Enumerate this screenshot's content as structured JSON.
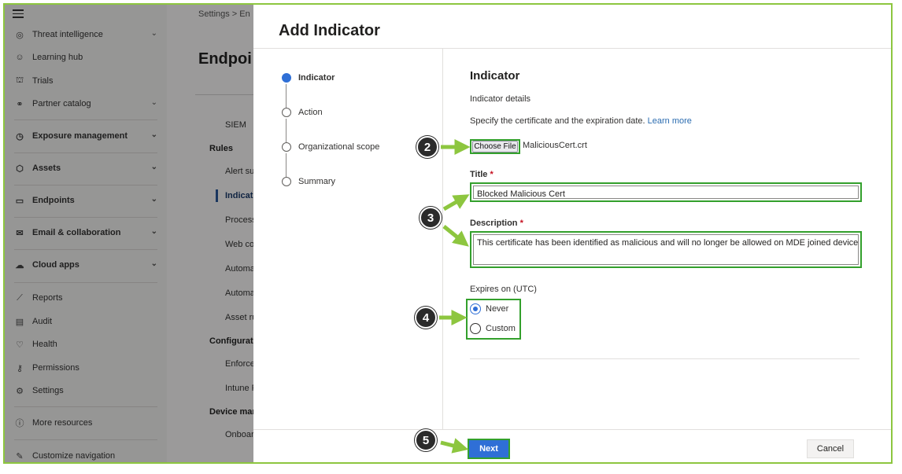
{
  "nav": {
    "items": [
      {
        "label": "Threat intelligence",
        "icon": "threat-intel-icon",
        "chevron": true
      },
      {
        "label": "Learning hub",
        "icon": "learning-hub-icon",
        "chevron": false
      },
      {
        "label": "Trials",
        "icon": "trials-icon",
        "chevron": false
      },
      {
        "label": "Partner catalog",
        "icon": "partner-catalog-icon",
        "chevron": true
      },
      {
        "label": "Exposure management",
        "icon": "exposure-icon",
        "chevron": true
      },
      {
        "label": "Assets",
        "icon": "assets-icon",
        "chevron": true
      },
      {
        "label": "Endpoints",
        "icon": "endpoints-icon",
        "chevron": true
      },
      {
        "label": "Email & collaboration",
        "icon": "email-icon",
        "chevron": true
      },
      {
        "label": "Cloud apps",
        "icon": "cloud-icon",
        "chevron": true
      },
      {
        "label": "Reports",
        "icon": "reports-icon",
        "chevron": false
      },
      {
        "label": "Audit",
        "icon": "audit-icon",
        "chevron": false
      },
      {
        "label": "Health",
        "icon": "health-icon",
        "chevron": false
      },
      {
        "label": "Permissions",
        "icon": "permissions-icon",
        "chevron": false
      },
      {
        "label": "Settings",
        "icon": "settings-icon",
        "chevron": false
      },
      {
        "label": "More resources",
        "icon": "info-icon",
        "chevron": false
      },
      {
        "label": "Customize navigation",
        "icon": "edit-icon",
        "chevron": false
      }
    ]
  },
  "background": {
    "breadcrumb": "Settings  >  En",
    "title": "Endpoi",
    "items": [
      "SIEM",
      "Rules",
      "Alert su",
      "Indicato",
      "Process",
      "Web co",
      "Automa",
      "Automa",
      "Asset ru",
      "Configurati",
      "Enforce",
      "Intune F",
      "Device man",
      "Onboar"
    ]
  },
  "panel": {
    "title": "Add Indicator",
    "steps": [
      "Indicator",
      "Action",
      "Organizational scope",
      "Summary"
    ],
    "section_title": "Indicator",
    "subtitle": "Indicator details",
    "instruction": "Specify the certificate and the expiration date.",
    "learn_more": "Learn more",
    "choose_file_label": "Choose File",
    "file_name": "MaliciousCert.crt",
    "title_label": "Title",
    "title_value": "Blocked Malicious Cert",
    "description_label": "Description",
    "description_value": "This certificate has been identified as malicious and will no longer be allowed on MDE joined devices.",
    "required_mark": "*",
    "expires_label": "Expires on (UTC)",
    "expires_options": [
      "Never",
      "Custom"
    ],
    "expires_selected": "Never",
    "next_label": "Next",
    "cancel_label": "Cancel"
  },
  "callouts": [
    "2",
    "3",
    "4",
    "5"
  ],
  "colors": {
    "accent": "#2f6fd6",
    "highlight": "#33a02c",
    "arrow": "#8dc63f"
  }
}
